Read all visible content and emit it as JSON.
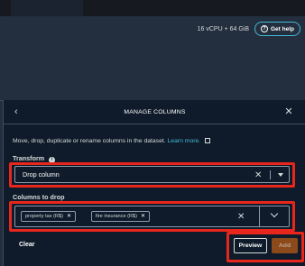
{
  "header": {
    "resources": "16 vCPU + 64 GiB",
    "help_label": "Get help",
    "help_icon": "question-circle-icon"
  },
  "panel": {
    "title": "MANAGE COLUMNS",
    "back_icon": "chevron-left-icon",
    "close_icon": "close-icon",
    "description": "Move, drop, duplicate or rename columns in the dataset.",
    "learn_more": "Learn more",
    "transform": {
      "label": "Transform",
      "value": "Drop column"
    },
    "columns_to_drop": {
      "label": "Columns to drop",
      "tags": [
        {
          "label": "property tax (R$)"
        },
        {
          "label": "fire insurance (R$)"
        }
      ]
    },
    "actions": {
      "clear": "Clear",
      "preview": "Preview",
      "add": "Add"
    }
  },
  "colors": {
    "highlight": "#e8261c",
    "link": "#44b9d6",
    "add_button": "#8c4a1b",
    "panel_bg": "#0f1b2a",
    "header_bg": "#232f3e"
  }
}
